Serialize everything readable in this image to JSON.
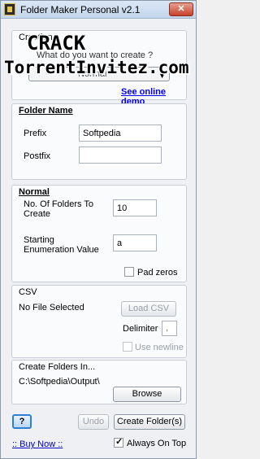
{
  "window": {
    "title": "Folder Maker Personal v2.1",
    "close_symbol": "✕"
  },
  "creation": {
    "title": "Creation",
    "question": "What do you want to create ?",
    "mode_selected": "Normal",
    "demo_link": "See online demo"
  },
  "watermark": {
    "line1": "CRACK",
    "line2": "TorrentInvitez.com"
  },
  "folder_name": {
    "title": "Folder Name",
    "prefix_label": "Prefix",
    "prefix_value": "Softpedia",
    "postfix_label": "Postfix",
    "postfix_value": ""
  },
  "normal": {
    "title": "Normal",
    "count_label_line1": "No. Of Folders To",
    "count_label_line2": "Create",
    "count_value": "10",
    "start_label_line1": "Starting",
    "start_label_line2": "Enumeration Value",
    "start_value": "a",
    "pad_zeros_label": "Pad zeros",
    "pad_zeros_checked": false
  },
  "csv": {
    "title": "CSV",
    "file_status": "No File Selected",
    "load_button": "Load CSV",
    "delimiter_label": "Delimiter",
    "delimiter_value": ",",
    "use_newline_label": "Use newline",
    "use_newline_checked": false
  },
  "create_in": {
    "title": "Create Folders In...",
    "path": "C:\\Softpedia\\Output\\",
    "browse_button": "Browse"
  },
  "footer": {
    "help_button": "?",
    "undo_button": "Undo",
    "create_button": "Create Folder(s)",
    "buy_link": ":: Buy Now ::",
    "always_on_top_label": "Always On Top",
    "always_on_top_checked": true
  }
}
